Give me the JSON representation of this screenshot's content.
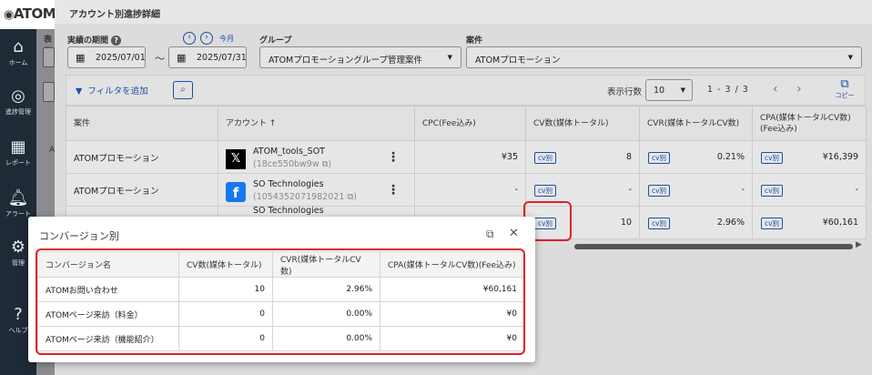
{
  "app": {
    "logo": "ATOM"
  },
  "sidebar": [
    {
      "icon": "home-icon",
      "glyph": "⌂",
      "label": "ホーム"
    },
    {
      "icon": "progress-icon",
      "glyph": "◎",
      "label": "進捗管理"
    },
    {
      "icon": "report-icon",
      "glyph": "▦",
      "label": "レポート"
    },
    {
      "icon": "bell-icon",
      "glyph": "🔔︎",
      "label": "アラート"
    },
    {
      "icon": "gear-icon",
      "glyph": "⚙",
      "label": "管理"
    },
    {
      "icon": "help-icon",
      "glyph": "?",
      "label": "ヘルプ"
    }
  ],
  "peek": {
    "title": "表示",
    "row_prefix": "A"
  },
  "page": {
    "title": "アカウント別進捗詳細"
  },
  "filters": {
    "period_label": "実績の期間",
    "help_glyph": "?",
    "date_from": "2025/07/01",
    "tilde": "〜",
    "date_to": "2025/07/31",
    "prev_glyph": "‹",
    "next_glyph": "›",
    "today_label": "今月",
    "group_label": "グループ",
    "group_value": "ATOMプロモーショングループ管理案件",
    "case_label": "案件",
    "case_value": "ATOMプロモーション"
  },
  "toolbar": {
    "filter_label": "フィルタを追加",
    "rows_label": "表示行数",
    "rows_value": "10",
    "pager": "1 - 3 / 3",
    "copy_label": "コピー"
  },
  "table": {
    "headers": [
      "案件",
      "アカウント ↑",
      "CPC(Fee込み)",
      "CV数(媒体トータル)",
      "CVR(媒体トータルCV数)",
      "CPA(媒体トータルCV数)(Fee込み)"
    ],
    "cv_tag": "cv別",
    "rows": [
      {
        "case": "ATOMプロモーション",
        "platform": "x",
        "platform_glyph": "𝕏",
        "account": "ATOM_tools_SOT",
        "account_id": "(18ce550bw9w ⧉)",
        "cpc": "¥35",
        "cv": "8",
        "cvr": "0.21%",
        "cpa": "¥16,399"
      },
      {
        "case": "ATOMプロモーション",
        "platform": "facebook",
        "platform_glyph": "f",
        "account": "SO Technologies",
        "account_id": "(1054352071982021 ⧉)",
        "cpc": "-",
        "cv": "-",
        "cvr": "-",
        "cpa": "-"
      },
      {
        "case": "",
        "platform": "facebook",
        "platform_glyph": "",
        "account": "SO Technologies",
        "account_id": "",
        "cpc": "",
        "cv": "10",
        "cvr": "2.96%",
        "cpa": "¥60,161"
      }
    ]
  },
  "popup": {
    "title": "コンバージョン別",
    "headers": [
      "コンバージョン名",
      "CV数(媒体トータル)",
      "CVR(媒体トータルCV数)",
      "CPA(媒体トータルCV数)(Fee込み)"
    ],
    "rows": [
      {
        "name": "ATOMお問い合わせ",
        "cv": "10",
        "cvr": "2.96%",
        "cpa": "¥60,161"
      },
      {
        "name": "ATOMページ来訪（料金）",
        "cv": "0",
        "cvr": "0.00%",
        "cpa": "¥0"
      },
      {
        "name": "ATOMページ来訪（機能紹介）",
        "cv": "0",
        "cvr": "0.00%",
        "cpa": "¥0"
      }
    ]
  },
  "colors": {
    "accent": "#1b4fa8",
    "highlight": "#e0202a",
    "sidebar": "#1f2a37"
  }
}
